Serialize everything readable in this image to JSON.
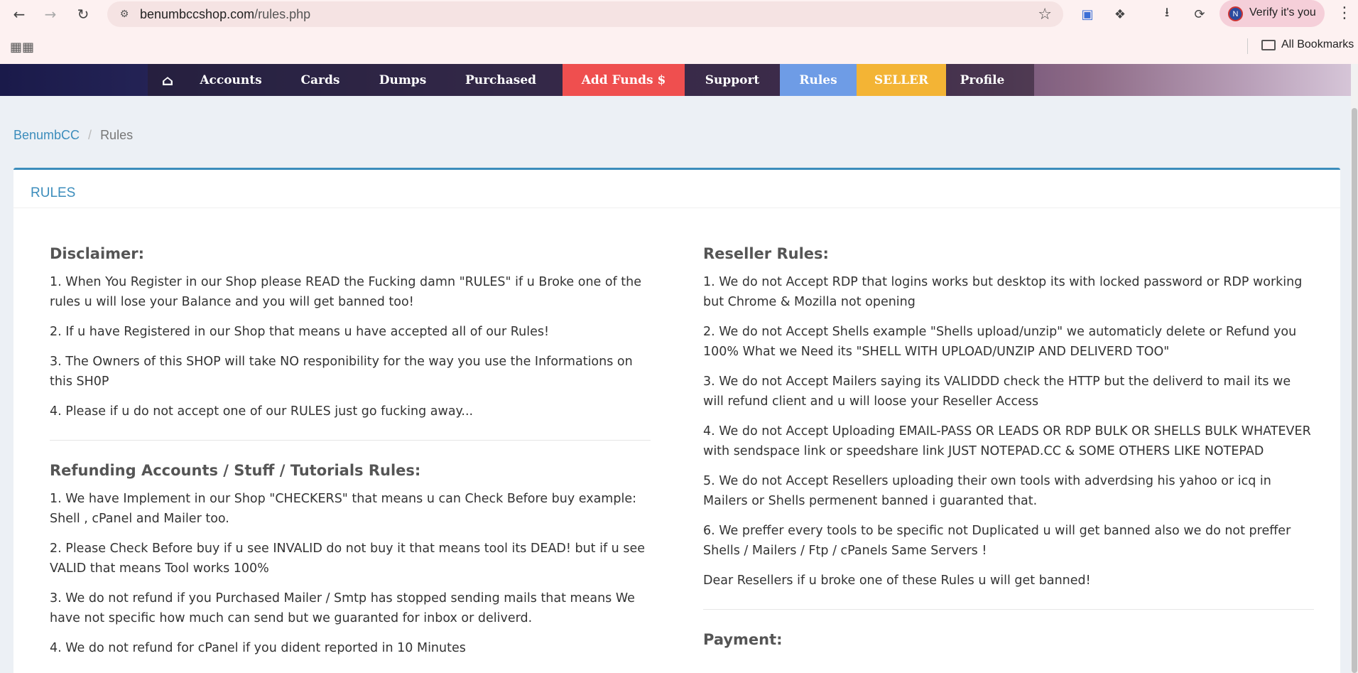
{
  "browser": {
    "url_domain": "benumbccshop.com",
    "url_path": "/rules.php",
    "verify_label": "Verify it's you",
    "avatar_letter": "N",
    "all_bookmarks": "All Bookmarks"
  },
  "nav": {
    "home_icon": "home-icon",
    "items": [
      "Accounts",
      "Cards",
      "Dumps",
      "Purchased",
      "Add Funds $",
      "Support",
      "Rules",
      "SELLER",
      "Profile"
    ],
    "colors": {
      "funds": "#ef4f4f",
      "rules": "#6e9ce6",
      "seller": "#f3b435"
    }
  },
  "breadcrumb": {
    "home": "BenumbCC",
    "separator": "/",
    "current": "Rules"
  },
  "panel": {
    "title": "RULES"
  },
  "left": {
    "disclaimer_title": "Disclaimer:",
    "disclaimer": [
      "1. When You Register in our Shop please READ the Fucking damn \"RULES\" if u Broke one of the rules u will lose your Balance and you will get banned too!",
      "2. If u have Registered in our Shop that means u have accepted all of our Rules!",
      "3. The Owners of this SHOP will take NO responibility for the way you use the Informations on this SH0P",
      "4. Please if u do not accept one of our RULES just go fucking away..."
    ],
    "refund_title": "Refunding Accounts / Stuff / Tutorials Rules:",
    "refund": [
      "1. We have Implement in our Shop \"CHECKERS\" that means u can Check Before buy example: Shell , cPanel and Mailer too.",
      "2. Please Check Before buy if u see INVALID do not buy it that means tool its DEAD! but if u see VALID that means Tool works 100%",
      "3. We do not refund if you Purchased Mailer / Smtp has stopped sending mails that means We have not specific how much can send but we guaranted for inbox or deliverd.",
      "4. We do not refund for cPanel if you dident reported in 10 Minutes"
    ]
  },
  "right": {
    "reseller_title": "Reseller Rules:",
    "reseller": [
      "1. We do not Accept RDP that logins works but desktop its with locked password or RDP working but Chrome & Mozilla not opening",
      "2. We do not Accept Shells example \"Shells upload/unzip\" we automaticly delete or Refund you 100% What we Need its \"SHELL WITH UPLOAD/UNZIP AND DELIVERD TOO\"",
      "3. We do not Accept Mailers saying its VALIDDD check the HTTP but the deliverd to mail its we will refund client and u will loose your Reseller Access",
      "4. We do not Accept Uploading EMAIL-PASS OR LEADS OR RDP BULK OR SHELLS BULK WHATEVER with sendspace link or speedshare link JUST NOTEPAD.CC & SOME OTHERS LIKE NOTEPAD",
      "5. We do not Accept Resellers uploading their own tools with adverdsing his yahoo or icq in Mailers or Shells permenent banned i guaranted that.",
      "6. We preffer every tools to be specific not Duplicated u will get banned also we do not preffer Shells / Mailers / Ftp / cPanels Same Servers !",
      "Dear Resellers if u broke one of these Rules u will get banned!"
    ],
    "payment_title": "Payment:"
  }
}
